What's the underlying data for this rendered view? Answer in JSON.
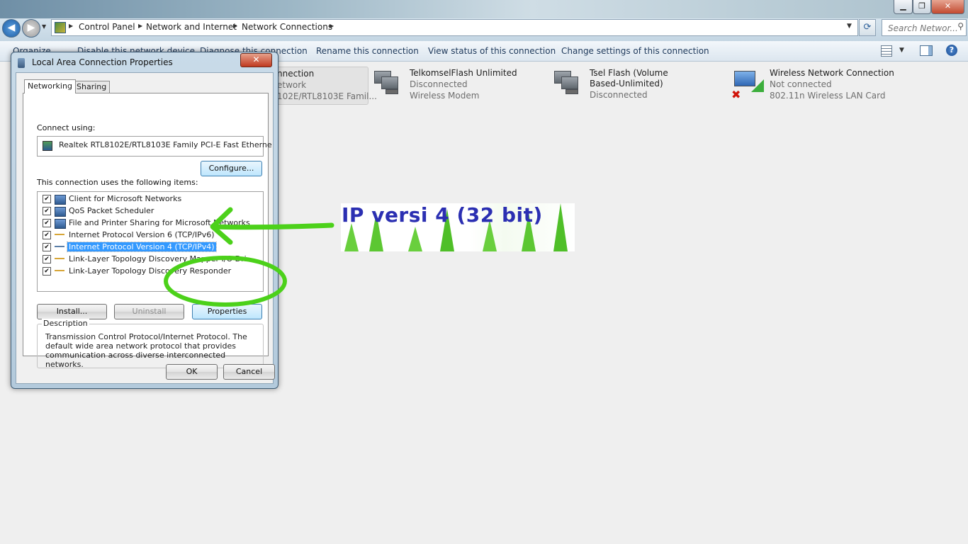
{
  "addressbar": {
    "crumbs": [
      "Control Panel",
      "Network and Internet",
      "Network Connections"
    ],
    "search_placeholder": "Search Networ..."
  },
  "commandbar": {
    "items": [
      "Organize",
      "Disable this network device",
      "Diagnose this connection",
      "Rename this connection",
      "View status of this connection",
      "Change settings of this connection"
    ]
  },
  "connections": [
    {
      "name": "Local Area Connection",
      "name_visible": "nnection",
      "status": "Network",
      "status_visible": "etwork",
      "device": "Realtek RTL8102E/RTL8103E Famil...",
      "device_visible": "102E/RTL8103E Famil..."
    },
    {
      "name": "TelkomselFlash Unlimited",
      "status": "Disconnected",
      "device": "Wireless Modem"
    },
    {
      "name_lines": [
        "Tsel Flash (Volume",
        "Based-Unlimited)"
      ],
      "status": "Disconnected"
    },
    {
      "name": "Wireless Network Connection",
      "status": "Not connected",
      "device": "802.11n Wireless LAN Card"
    }
  ],
  "dialog": {
    "title": "Local Area Connection Properties",
    "close": "✕",
    "tabs": [
      "Networking",
      "Sharing"
    ],
    "connect_using_label": "Connect using:",
    "adapter": "Realtek RTL8102E/RTL8103E Family PCI-E Fast Etherne",
    "configure": "Configure...",
    "items_label": "This connection uses the following items:",
    "items": [
      {
        "label": "Client for Microsoft Networks",
        "checked": true,
        "icon": "network-client-icon"
      },
      {
        "label": "QoS Packet Scheduler",
        "checked": true,
        "icon": "network-service-icon"
      },
      {
        "label": "File and Printer Sharing for Microsoft Networks",
        "checked": true,
        "icon": "network-service-icon"
      },
      {
        "label": "Internet Protocol Version 6 (TCP/IPv6)",
        "checked": true,
        "icon": "protocol-icon"
      },
      {
        "label": "Internet Protocol Version 4 (TCP/IPv4)",
        "checked": true,
        "icon": "protocol-icon",
        "selected": true
      },
      {
        "label": "Link-Layer Topology Discovery Mapper I/O Dri",
        "checked": true,
        "icon": "protocol-icon"
      },
      {
        "label": "Link-Layer Topology Discovery Responder",
        "checked": true,
        "icon": "protocol-icon"
      }
    ],
    "buttons": {
      "install": "Install...",
      "uninstall": "Uninstall",
      "properties": "Properties",
      "ok": "OK",
      "cancel": "Cancel"
    },
    "description_title": "Description",
    "description": "Transmission Control Protocol/Internet Protocol. The default wide area network protocol that provides communication across diverse interconnected networks."
  },
  "annotation": {
    "text": "IP versi 4 (32 bit)",
    "color": "#2b2fb2",
    "marker_color": "#4cd11a"
  },
  "colors": {
    "selection": "#3399ff",
    "close_button": "#c0391f"
  }
}
